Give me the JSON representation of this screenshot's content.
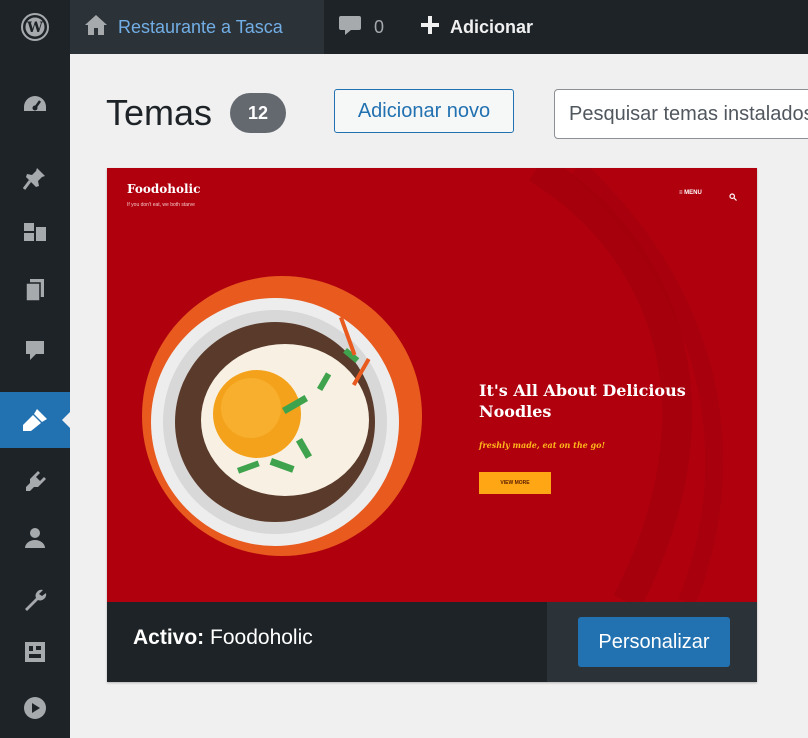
{
  "adminbar": {
    "site_name": "Restaurante a Tasca",
    "comments_count": "0",
    "new_label": "Adicionar"
  },
  "sidebar": {
    "icons": [
      "dashboard-icon",
      "pin-icon",
      "media-icon",
      "pages-icon",
      "comments-icon",
      "appearance-icon",
      "plugins-icon",
      "users-icon",
      "tools-icon",
      "settings-icon",
      "play-icon"
    ],
    "active": "appearance-icon"
  },
  "page": {
    "title": "Temas",
    "count": "12",
    "add_new_label": "Adicionar novo",
    "search_placeholder": "Pesquisar temas instalados..."
  },
  "theme": {
    "screenshot": {
      "brand": "Foodoholic",
      "tagline": "If you don't eat, we both starve",
      "menu_label": "≡ MENU",
      "headline": "It's All About Delicious Noodles",
      "subline": "freshly made, eat on the go!",
      "button": "VIEW MORE"
    },
    "active_prefix": "Activo:",
    "name": "Foodoholic",
    "customize_label": "Personalizar"
  },
  "colors": {
    "adminbar": "#1d2327",
    "accent": "#2271b1",
    "theme_bg": "#b0000e",
    "link": "#72aee6"
  }
}
